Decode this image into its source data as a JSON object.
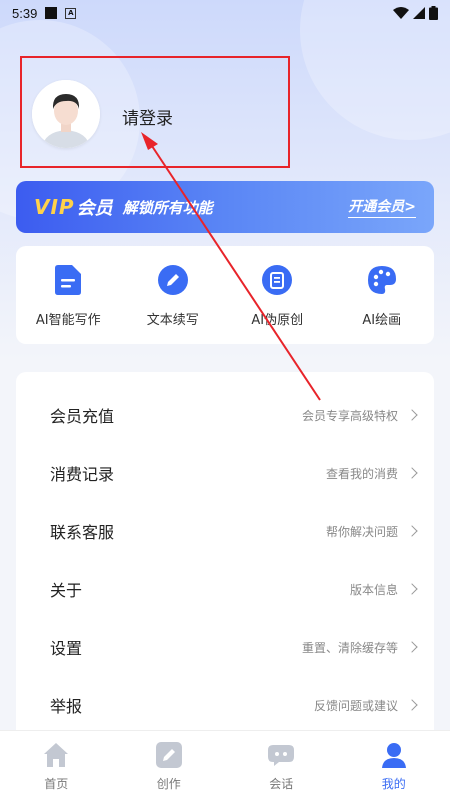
{
  "status_bar": {
    "time": "5:39"
  },
  "profile": {
    "login_label": "请登录"
  },
  "vip_banner": {
    "brand": "VIP",
    "member": "会员",
    "unlock_label": "解锁所有功能",
    "open_label": "开通会员>"
  },
  "features": [
    {
      "label": "AI智能写作",
      "icon": "document-icon"
    },
    {
      "label": "文本续写",
      "icon": "pencil-icon"
    },
    {
      "label": "AI伪原创",
      "icon": "article-icon"
    },
    {
      "label": "AI绘画",
      "icon": "palette-icon"
    }
  ],
  "menu": [
    {
      "label": "会员充值",
      "hint": "会员专享高级特权"
    },
    {
      "label": "消费记录",
      "hint": "查看我的消费"
    },
    {
      "label": "联系客服",
      "hint": "帮你解决问题"
    },
    {
      "label": "关于",
      "hint": "版本信息"
    },
    {
      "label": "设置",
      "hint": "重置、清除缓存等"
    },
    {
      "label": "举报",
      "hint": "反馈问题或建议"
    }
  ],
  "tabs": [
    {
      "label": "首页",
      "icon": "home-icon"
    },
    {
      "label": "创作",
      "icon": "create-icon"
    },
    {
      "label": "会话",
      "icon": "chat-icon"
    },
    {
      "label": "我的",
      "icon": "profile-icon"
    }
  ],
  "colors": {
    "accent": "#3a6cf4",
    "highlight_box": "#e8242a",
    "vip_gold": "#ffd24a"
  }
}
